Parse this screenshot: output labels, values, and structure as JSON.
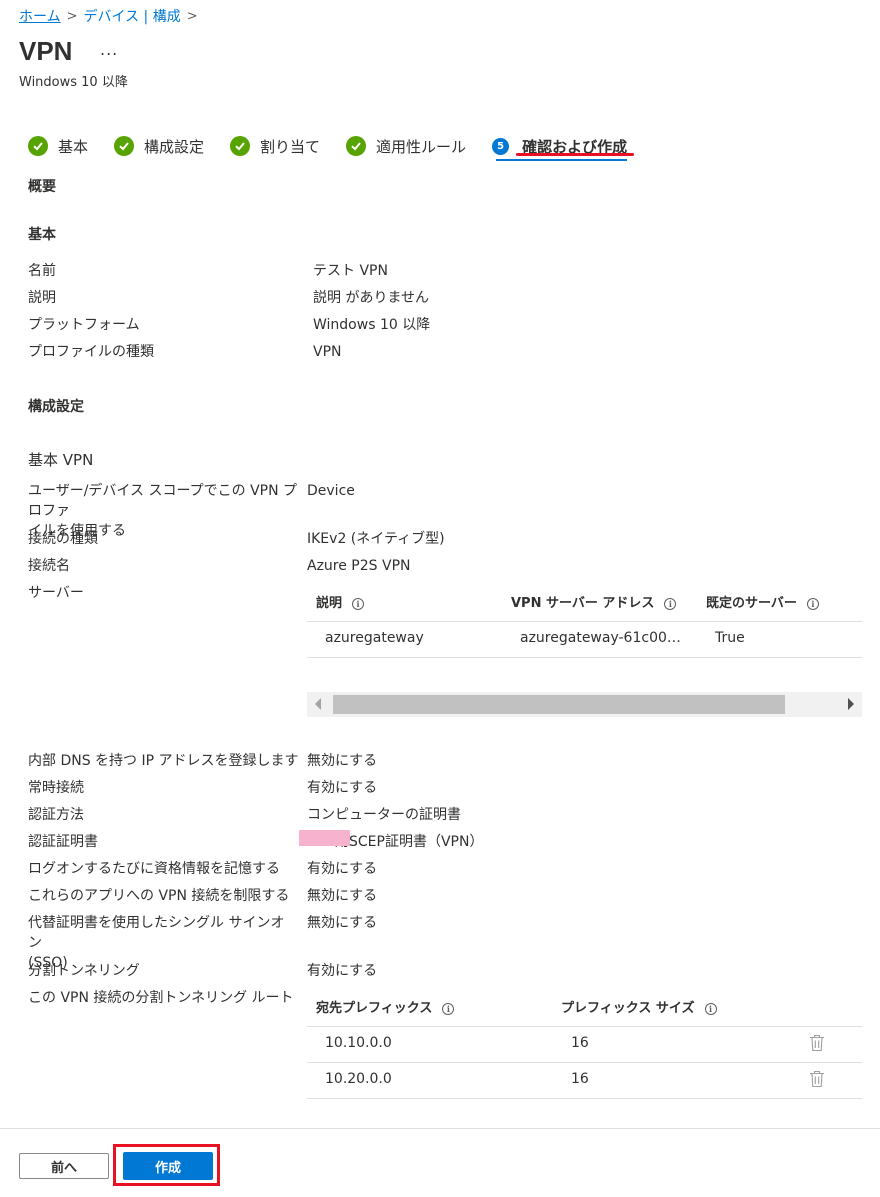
{
  "breadcrumb": {
    "home": "ホーム",
    "sep": ">",
    "devices": "デバイス | 構成"
  },
  "page": {
    "title": "VPN",
    "more": "...",
    "subtitle": "Windows 10 以降"
  },
  "steps": [
    {
      "label": "基本"
    },
    {
      "label": "構成設定"
    },
    {
      "label": "割り当て"
    },
    {
      "label": "適用性ルール"
    },
    {
      "number": "5",
      "label": "確認および作成"
    }
  ],
  "summary": {
    "heading": "概要"
  },
  "basics": {
    "heading": "基本",
    "rows": [
      {
        "label": "名前",
        "value": "テスト VPN"
      },
      {
        "label": "説明",
        "value": "説明 がありません"
      },
      {
        "label": "プラットフォーム",
        "value": "Windows 10 以降"
      },
      {
        "label": "プロファイルの種類",
        "value": "VPN"
      }
    ]
  },
  "config": {
    "heading": "構成設定",
    "subheading": "基本 VPN",
    "user_scope_label_1": "ユーザー/デバイス スコープでこの VPN プロファ",
    "user_scope_label_2": "イルを使用する",
    "user_scope_value": "Device",
    "conn_type_label": "接続の種類",
    "conn_type_value": "IKEv2 (ネイティブ型)",
    "conn_name_label": "接続名",
    "conn_name_value": "Azure P2S VPN",
    "server_label": "サーバー",
    "server_table": {
      "headers": [
        "説明",
        "VPN サーバー アドレス",
        "既定のサーバー"
      ],
      "row": [
        "azuregateway",
        "azuregateway-61c00…",
        "True"
      ]
    },
    "rows": [
      {
        "label": "内部 DNS を持つ IP アドレスを登録します",
        "value": "無効にする"
      },
      {
        "label": "常時接続",
        "value": "有効にする"
      },
      {
        "label": "認証方法",
        "value": "コンピューターの証明書"
      },
      {
        "label": "認証証明書",
        "value": "用SCEP証明書（VPN）"
      },
      {
        "label": "ログオンするたびに資格情報を記憶する",
        "value": "有効にする"
      },
      {
        "label": "これらのアプリへの VPN 接続を制限する",
        "value": "無効にする"
      }
    ],
    "sso_label_1": "代替証明書を使用したシングル サインオン",
    "sso_label_2": "(SSO)",
    "sso_value": "無効にする",
    "split_label": "分割トンネリング",
    "split_value": "有効にする",
    "routes_label": "この VPN 接続の分割トンネリング ルート",
    "routes_table": {
      "headers": [
        "宛先プレフィックス",
        "プレフィックス サイズ"
      ],
      "rows": [
        [
          "10.10.0.0",
          "16"
        ],
        [
          "10.20.0.0",
          "16"
        ]
      ]
    }
  },
  "footer": {
    "prev": "前へ",
    "create": "作成"
  },
  "colors": {
    "accent": "#0078d4",
    "success": "#57a300",
    "highlight": "#e81123",
    "redaction": "#f7b3cd"
  }
}
